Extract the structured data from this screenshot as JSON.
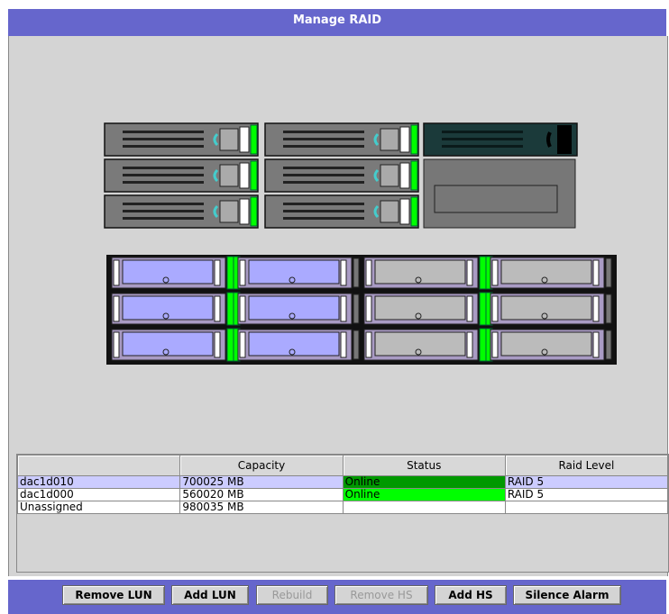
{
  "window": {
    "title": "Manage RAID"
  },
  "table": {
    "headers": [
      "",
      "Capacity",
      "Status",
      "Raid Level"
    ],
    "rows": [
      {
        "name": "dac1d010",
        "capacity": "700025 MB",
        "status": "Online",
        "status_color": "#009900",
        "raid_level": "RAID 5",
        "selected": true
      },
      {
        "name": "dac1d000",
        "capacity": "560020 MB",
        "status": "Online",
        "status_color": "#00ff00",
        "raid_level": "RAID 5",
        "selected": false
      },
      {
        "name": "Unassigned",
        "capacity": "980035 MB",
        "status": "",
        "status_color": "",
        "raid_level": "",
        "selected": false
      }
    ]
  },
  "buttons": {
    "remove_lun": "Remove LUN",
    "add_lun": "Add LUN",
    "rebuild": "Rebuild",
    "remove_hs": "Remove HS",
    "add_hs": "Add HS",
    "silence_alarm": "Silence Alarm"
  },
  "colors": {
    "titlebar": "#6666cc",
    "panel": "#d4d4d4",
    "drive_assigned": "#aaaaff",
    "drive_unassigned": "#bbbbbb",
    "led_green": "#00ff00"
  },
  "enclosures": {
    "top_bays": [
      [
        "drive-blank",
        "drive-blank",
        "drive-dark"
      ],
      [
        "drive-blank",
        "drive-blank",
        "empty"
      ],
      [
        "drive-blank",
        "drive-blank",
        "empty"
      ]
    ],
    "bottom_bays": [
      [
        "assigned",
        "assigned",
        "unassigned",
        "unassigned"
      ],
      [
        "assigned",
        "assigned",
        "unassigned",
        "unassigned"
      ],
      [
        "assigned",
        "assigned",
        "unassigned",
        "unassigned"
      ]
    ]
  }
}
